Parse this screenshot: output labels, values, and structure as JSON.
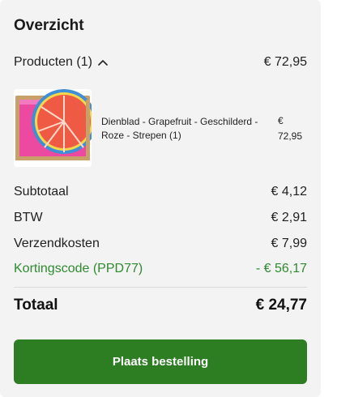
{
  "overview": {
    "title": "Overzicht",
    "products": {
      "label": "Producten (1)",
      "total": "€ 72,95",
      "toggle_icon": "chevron-up-icon"
    },
    "items": [
      {
        "name": "Dienblad - Grapefruit - Geschilderd - Roze - Strepen (1)",
        "price_currency": "€",
        "price_amount": "72,95",
        "image": "product-thumbnail"
      }
    ],
    "lines": {
      "subtotal_label": "Subtotaal",
      "subtotal_value": "€ 4,12",
      "btw_label": "BTW",
      "btw_value": "€ 2,91",
      "shipping_label": "Verzendkosten",
      "shipping_value": "€ 7,99",
      "discount_label": "Kortingscode (PPD77)",
      "discount_value": "- € 56,17"
    },
    "total_label": "Totaal",
    "total_value": "€ 24,77",
    "submit_label": "Plaats bestelling"
  },
  "colors": {
    "card_background": "#f3f3f3",
    "accent_green": "#2d7d23",
    "discount_green": "#2e8a2e"
  }
}
